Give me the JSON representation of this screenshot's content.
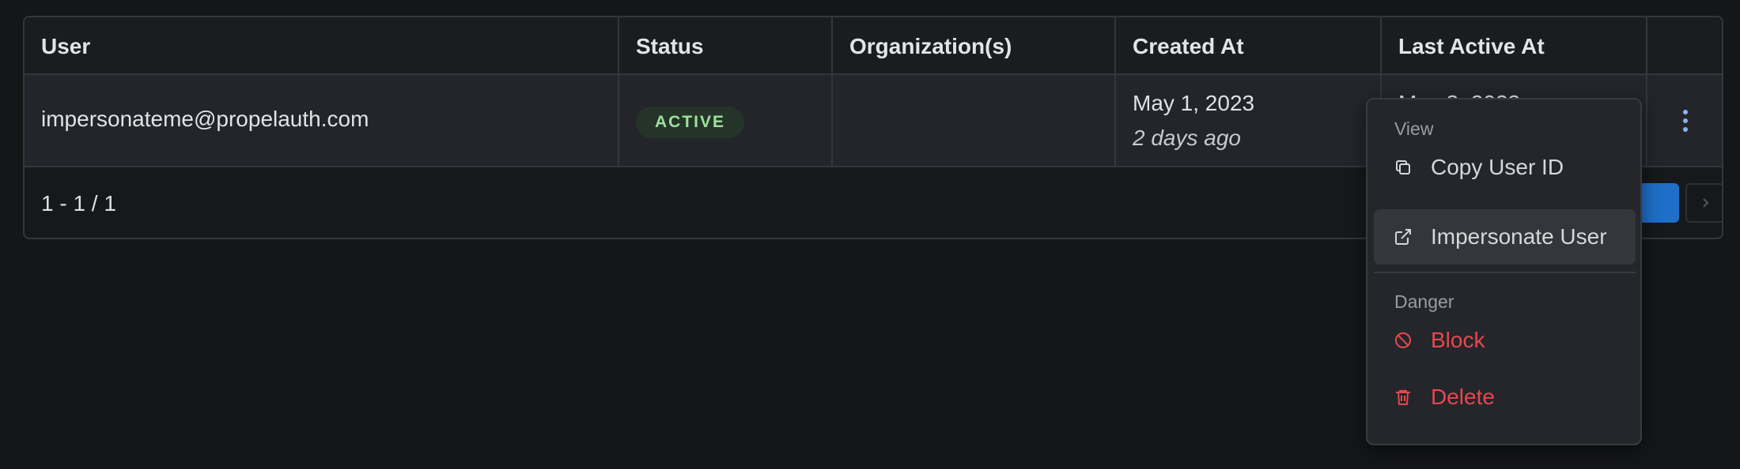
{
  "table": {
    "columns": [
      "User",
      "Status",
      "Organization(s)",
      "Created At",
      "Last Active At"
    ],
    "rows": [
      {
        "email": "impersonateme@propelauth.com",
        "status": "ACTIVE",
        "organizations": "",
        "created_at": "May 1, 2023",
        "created_relative": "2 days ago",
        "last_active_at": "May 3, 2023"
      }
    ],
    "pagination": "1 - 1 / 1"
  },
  "menu": {
    "section_view": "View",
    "copy_user_id": "Copy User ID",
    "impersonate_user": "Impersonate User",
    "section_danger": "Danger",
    "block": "Block",
    "delete": "Delete"
  },
  "colors": {
    "background": "#151618",
    "badge_bg": "#253428",
    "badge_text": "#9ee0a0",
    "danger": "#e5484d",
    "accent": "#1f6fc9"
  },
  "icons": [
    "copy-icon",
    "external-link-icon",
    "block-icon",
    "trash-icon",
    "kebab-icon",
    "chevron-right-icon"
  ]
}
